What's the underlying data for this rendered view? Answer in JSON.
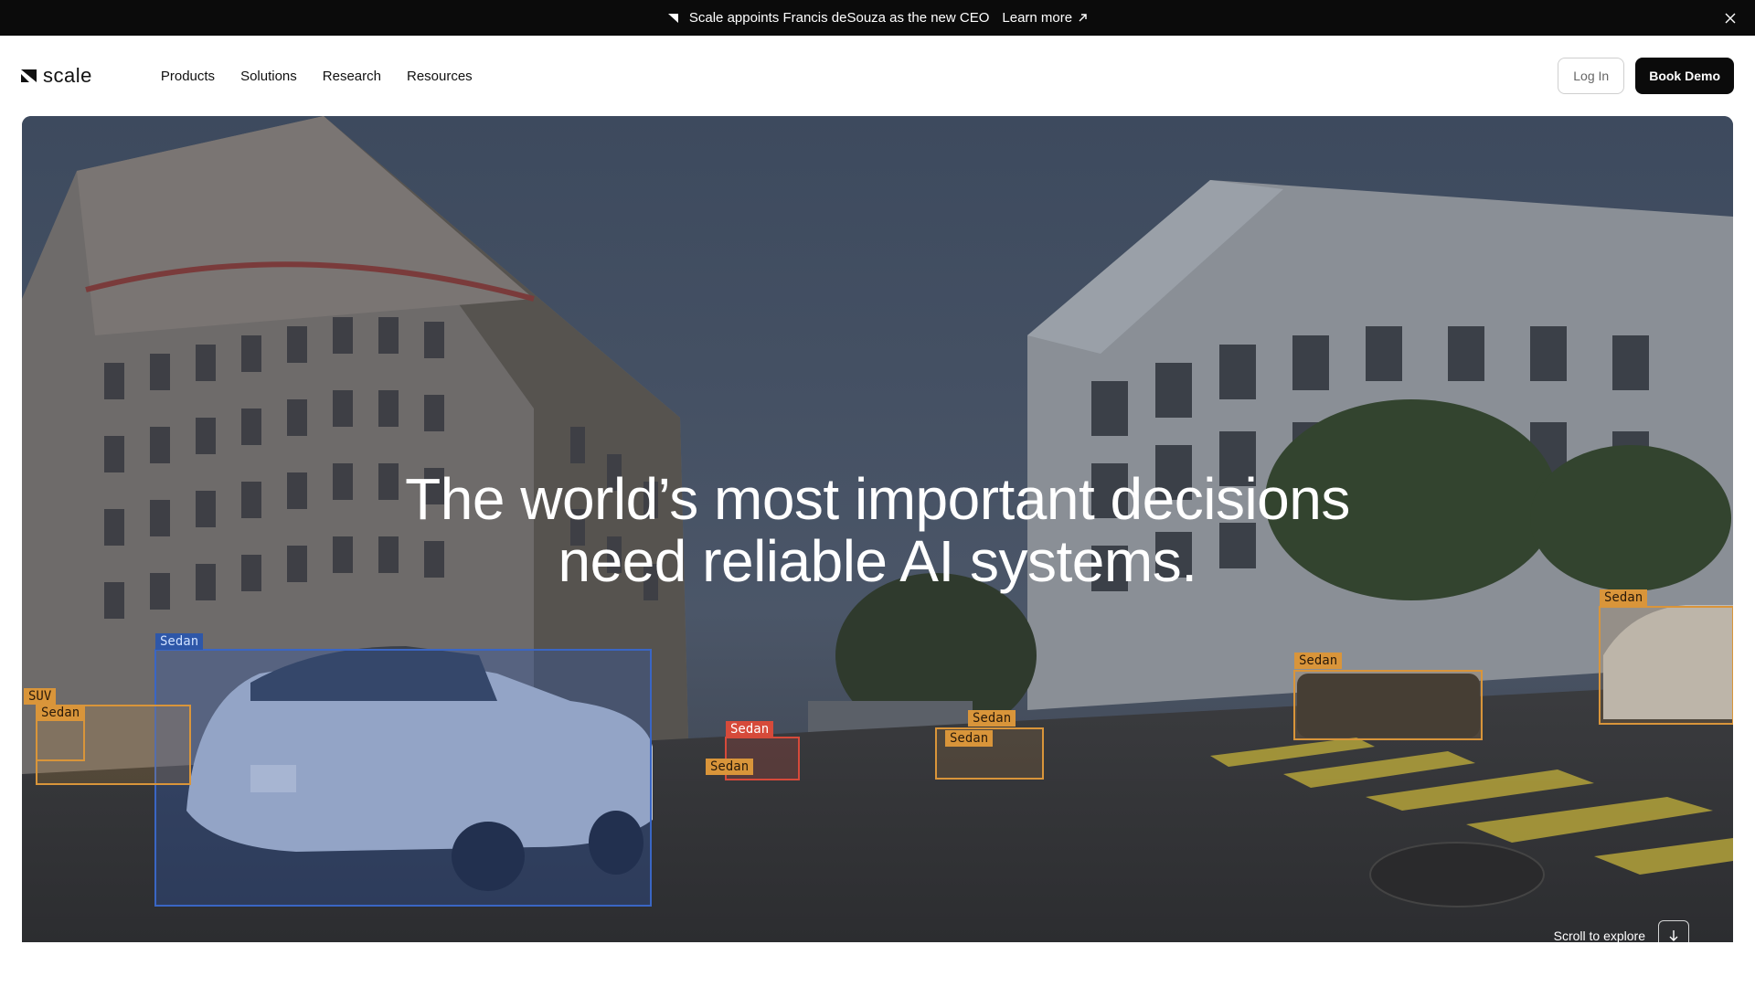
{
  "announcement": {
    "message": "Scale appoints Francis deSouza as the new CEO",
    "link_label": "Learn more"
  },
  "header": {
    "logo_text": "scale",
    "nav": [
      "Products",
      "Solutions",
      "Research",
      "Resources"
    ],
    "login_label": "Log In",
    "demo_label": "Book Demo"
  },
  "hero": {
    "title_line1": "The world’s most important decisions",
    "title_line2": "need reliable AI systems.",
    "labels": {
      "sedan_main": "Sedan",
      "suv": "SUV",
      "sedan_left": "Sedan",
      "sedan_red": "Sedan",
      "sedan_red_lower": "Sedan",
      "sedan_mid_top": "Sedan",
      "sedan_mid_bottom": "Sedan",
      "sedan_right_mid": "Sedan",
      "sedan_far_right": "Sedan"
    },
    "scroll_label": "Scroll to explore"
  },
  "colors": {
    "announce_bg": "#0b0b0b",
    "demo_bg": "#0b0b0b",
    "bbox_orange": "#d9953a",
    "bbox_blue": "#2e57a8",
    "bbox_red": "#d64a3a"
  }
}
